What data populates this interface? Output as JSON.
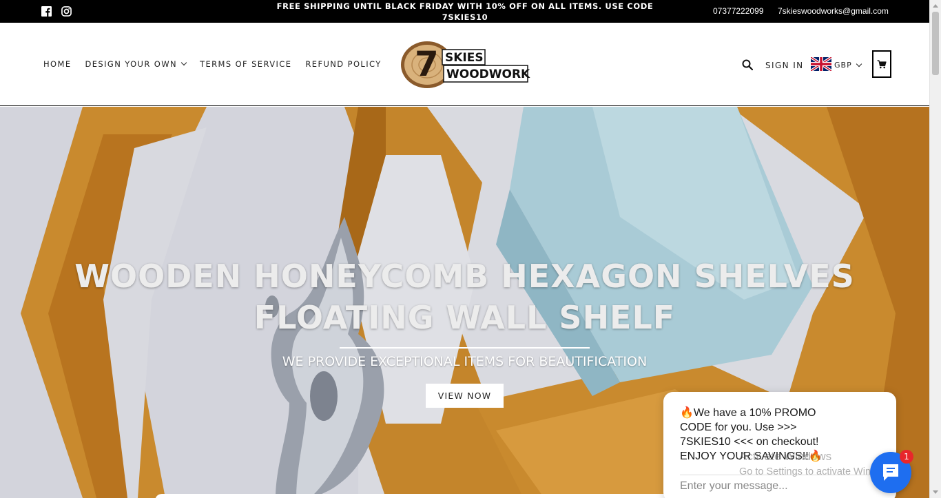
{
  "topbar": {
    "announcement": "FREE SHIPPING UNTIL BLACK FRIDAY WITH 10% OFF ON ALL ITEMS. USE CODE 7SKIES10",
    "phone": "07377222099",
    "email": "7skieswoodworks@gmail.com",
    "social_icons": [
      "facebook-icon",
      "instagram-icon"
    ]
  },
  "nav": {
    "items": [
      {
        "label": "HOME"
      },
      {
        "label": "DESIGN YOUR OWN",
        "has_dropdown": true
      },
      {
        "label": "TERMS OF SERVICE"
      },
      {
        "label": "REFUND POLICY"
      }
    ]
  },
  "logo": {
    "number": "7",
    "line1": "SKIES",
    "line2": "WOODWORKS"
  },
  "header_right": {
    "signin_label": "SIGN IN",
    "currency": "GBP",
    "flag": "uk-flag-icon",
    "search_icon": "search-icon",
    "cart_icon": "cart-icon"
  },
  "hero": {
    "title_line1": "WOODEN HONEYCOMB HEXAGON SHELVES",
    "title_line2": "FLOATING WALL SHELF",
    "subtitle": "WE PROVIDE EXCEPTIONAL ITEMS FOR BEAUTIFICATION",
    "button_label": "VIEW NOW"
  },
  "chat": {
    "message_line1": "We have a 10% PROMO",
    "message_line2": "CODE for you. Use >>>",
    "message_line3": "7SKIES10 <<< on checkout!",
    "message_line4": "ENJOY YOUR SAVINGS!!",
    "input_placeholder": "Enter your message...",
    "badge_count": "1",
    "colors": {
      "fab": "#1e6ef0",
      "badge": "#e8262b"
    }
  },
  "windows_watermark": {
    "line1": "Activate Windows",
    "line2": "Go to Settings to activate Windows."
  },
  "colors": {
    "topbar": "#000000",
    "wood": "#c98a2e",
    "wall": "#d9dae0",
    "vase": "#a9cbd6"
  }
}
